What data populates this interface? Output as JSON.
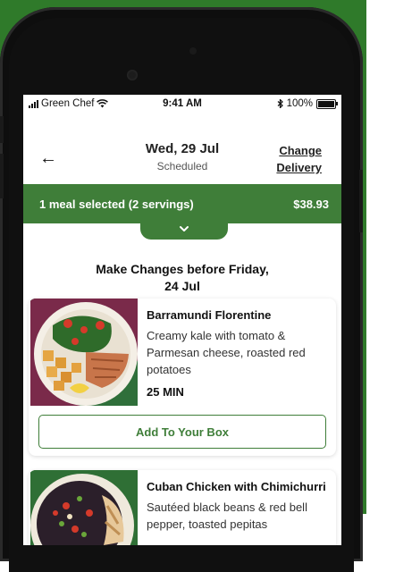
{
  "status_bar": {
    "carrier": "Green Chef",
    "time": "9:41 AM",
    "bluetooth": "bluetooth-icon",
    "battery": "100%",
    "battery_level": 1.0
  },
  "nav": {
    "back_icon": "arrow-left-icon",
    "date": "Wed, 29 Jul",
    "status": "Scheduled",
    "change_line1": "Change",
    "change_line2": "Delivery"
  },
  "banner": {
    "summary": "1 meal selected (2 servings)",
    "price": "$38.93",
    "toggle_icon": "chevron-down-icon"
  },
  "deadline": {
    "line1": "Make Changes before Friday,",
    "line2": "24 Jul"
  },
  "meals": [
    {
      "title": "Barramundi Florentine",
      "description": "Creamy kale with tomato & Parmesan cheese, roasted red potatoes",
      "time": "25 MIN",
      "button": "Add To Your Box"
    },
    {
      "title": "Cuban Chicken with Chimichurri",
      "description": "Sautéed black beans & red bell pepper, toasted pepitas"
    }
  ],
  "colors": {
    "brand_green": "#3f7e39",
    "background_green": "#2f7a2a"
  }
}
